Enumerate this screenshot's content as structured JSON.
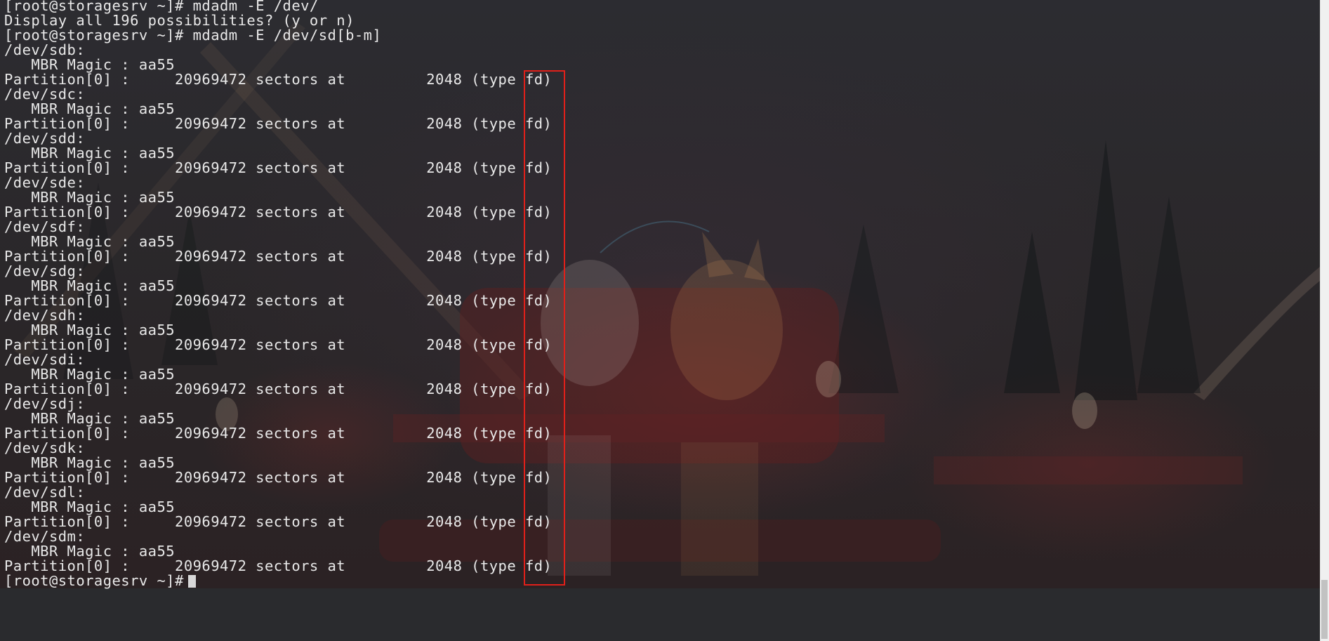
{
  "terminal": {
    "lines": [
      "[root@storagesrv ~]# mdadm -E /dev/",
      "Display all 196 possibilities? (y or n)",
      "[root@storagesrv ~]# mdadm -E /dev/sd[b-m]",
      "/dev/sdb:",
      "   MBR Magic : aa55",
      "Partition[0] :     20969472 sectors at         2048 (type fd)",
      "/dev/sdc:",
      "   MBR Magic : aa55",
      "Partition[0] :     20969472 sectors at         2048 (type fd)",
      "/dev/sdd:",
      "   MBR Magic : aa55",
      "Partition[0] :     20969472 sectors at         2048 (type fd)",
      "/dev/sde:",
      "   MBR Magic : aa55",
      "Partition[0] :     20969472 sectors at         2048 (type fd)",
      "/dev/sdf:",
      "   MBR Magic : aa55",
      "Partition[0] :     20969472 sectors at         2048 (type fd)",
      "/dev/sdg:",
      "   MBR Magic : aa55",
      "Partition[0] :     20969472 sectors at         2048 (type fd)",
      "/dev/sdh:",
      "   MBR Magic : aa55",
      "Partition[0] :     20969472 sectors at         2048 (type fd)",
      "/dev/sdi:",
      "   MBR Magic : aa55",
      "Partition[0] :     20969472 sectors at         2048 (type fd)",
      "/dev/sdj:",
      "   MBR Magic : aa55",
      "Partition[0] :     20969472 sectors at         2048 (type fd)",
      "/dev/sdk:",
      "   MBR Magic : aa55",
      "Partition[0] :     20969472 sectors at         2048 (type fd)",
      "/dev/sdl:",
      "   MBR Magic : aa55",
      "Partition[0] :     20969472 sectors at         2048 (type fd)",
      "/dev/sdm:",
      "   MBR Magic : aa55",
      "Partition[0] :     20969472 sectors at         2048 (type fd)"
    ],
    "prompt": "[root@storagesrv ~]#"
  },
  "colors": {
    "background": "#232427",
    "text": "#e8e8e8",
    "highlight": "#e0201a"
  },
  "icons": {
    "cursor": "block-cursor"
  }
}
